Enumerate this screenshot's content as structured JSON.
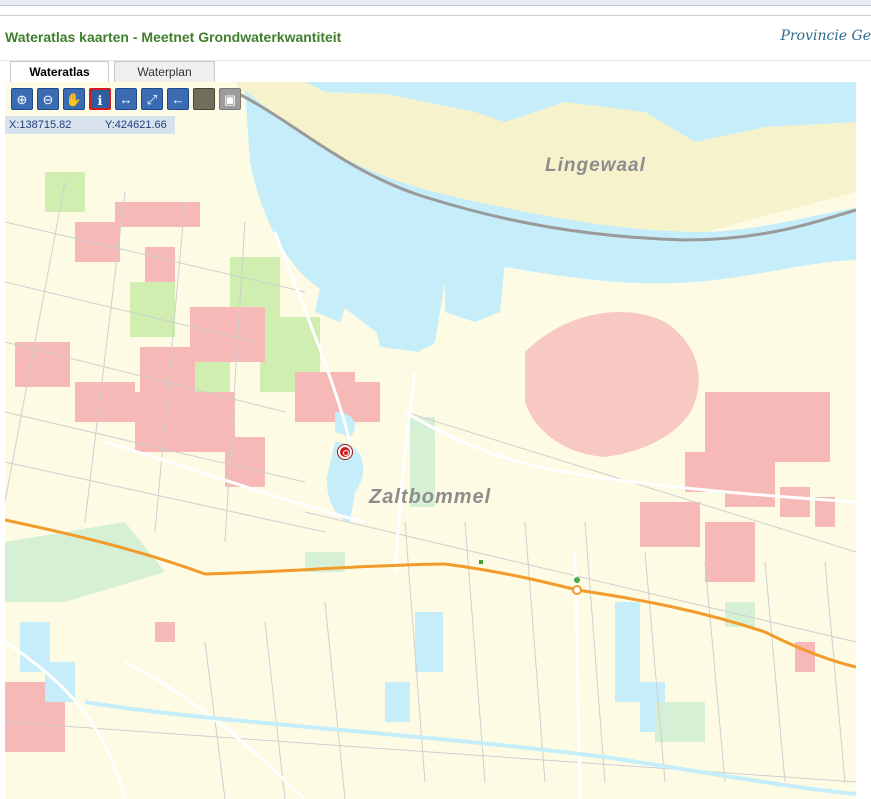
{
  "header": {
    "title": "Wateratlas kaarten - Meetnet Grondwaterkwantiteit",
    "provincie_link": "Provincie Ge"
  },
  "tabs": [
    {
      "label": "Wateratlas",
      "active": true
    },
    {
      "label": "Waterplan",
      "active": false
    }
  ],
  "toolbar": {
    "tools": [
      {
        "name": "zoom-in-icon",
        "glyph": "⊕"
      },
      {
        "name": "zoom-out-icon",
        "glyph": "⊖"
      },
      {
        "name": "pan-hand-icon",
        "glyph": "✋"
      },
      {
        "name": "info-icon",
        "glyph": "ℹ",
        "selected": true
      },
      {
        "name": "measure-icon",
        "glyph": "↔"
      },
      {
        "name": "full-extent-icon",
        "glyph": "⤢"
      },
      {
        "name": "back-arrow-icon",
        "glyph": "←"
      },
      {
        "name": "aerial-photo-icon",
        "glyph": ""
      },
      {
        "name": "layer-toggle-icon",
        "glyph": "▣"
      }
    ]
  },
  "coords": {
    "x": "X:138715.82",
    "y": "Y:424621.66"
  },
  "map": {
    "labels": {
      "river": "Lingewaal",
      "town": "Zaltbommel"
    },
    "colors": {
      "water": "#c5eefa",
      "built_up": "#f7b8b8",
      "grass": "#cfeeb0",
      "road": "#f19b2c",
      "land": "#fdfbe4"
    }
  }
}
